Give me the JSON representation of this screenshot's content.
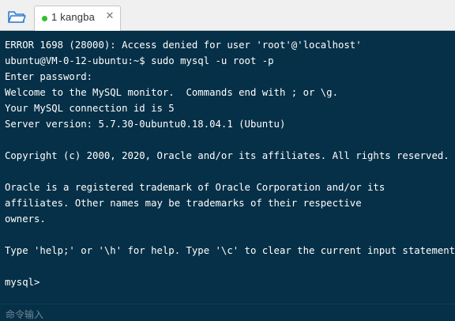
{
  "tabbar": {
    "open_icon": "folder-icon",
    "tabs": [
      {
        "title": "1 kangba",
        "status_color": "#2ec12e",
        "close_glyph": "✕"
      }
    ]
  },
  "terminal": {
    "background": "#063047",
    "foreground": "#ffffff",
    "lines": [
      "ERROR 1698 (28000): Access denied for user 'root'@'localhost'",
      "ubuntu@VM-0-12-ubuntu:~$ sudo mysql -u root -p",
      "Enter password:",
      "Welcome to the MySQL monitor.  Commands end with ; or \\g.",
      "Your MySQL connection id is 5",
      "Server version: 5.7.30-0ubuntu0.18.04.1 (Ubuntu)",
      "",
      "Copyright (c) 2000, 2020, Oracle and/or its affiliates. All rights reserved.",
      "",
      "Oracle is a registered trademark of Oracle Corporation and/or its",
      "affiliates. Other names may be trademarks of their respective",
      "owners.",
      "",
      "Type 'help;' or '\\h' for help. Type '\\c' to clear the current input statement.",
      "",
      "mysql>"
    ]
  },
  "command_input": {
    "placeholder": "命令输入"
  }
}
